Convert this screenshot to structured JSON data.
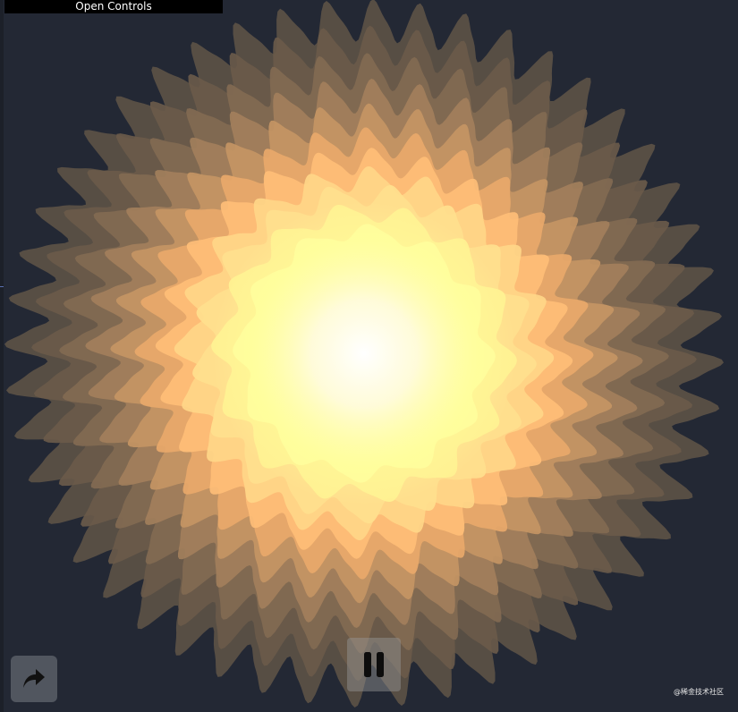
{
  "controls": {
    "open_label": "Open Controls"
  },
  "buttons": {
    "share_icon": "share-arrow-icon",
    "pause_icon": "pause-icon"
  },
  "watermark": {
    "text": "@稀金技术社区"
  },
  "colors": {
    "background": "#232834",
    "layers": [
      "#5b5046",
      "#6a5a4a",
      "#826a52",
      "#a3805c",
      "#c59664",
      "#eaaa6a",
      "#ffbf78",
      "#ffd688",
      "#ffe08e",
      "#fff392",
      "#ffff9e"
    ],
    "core": "#ffffff"
  }
}
